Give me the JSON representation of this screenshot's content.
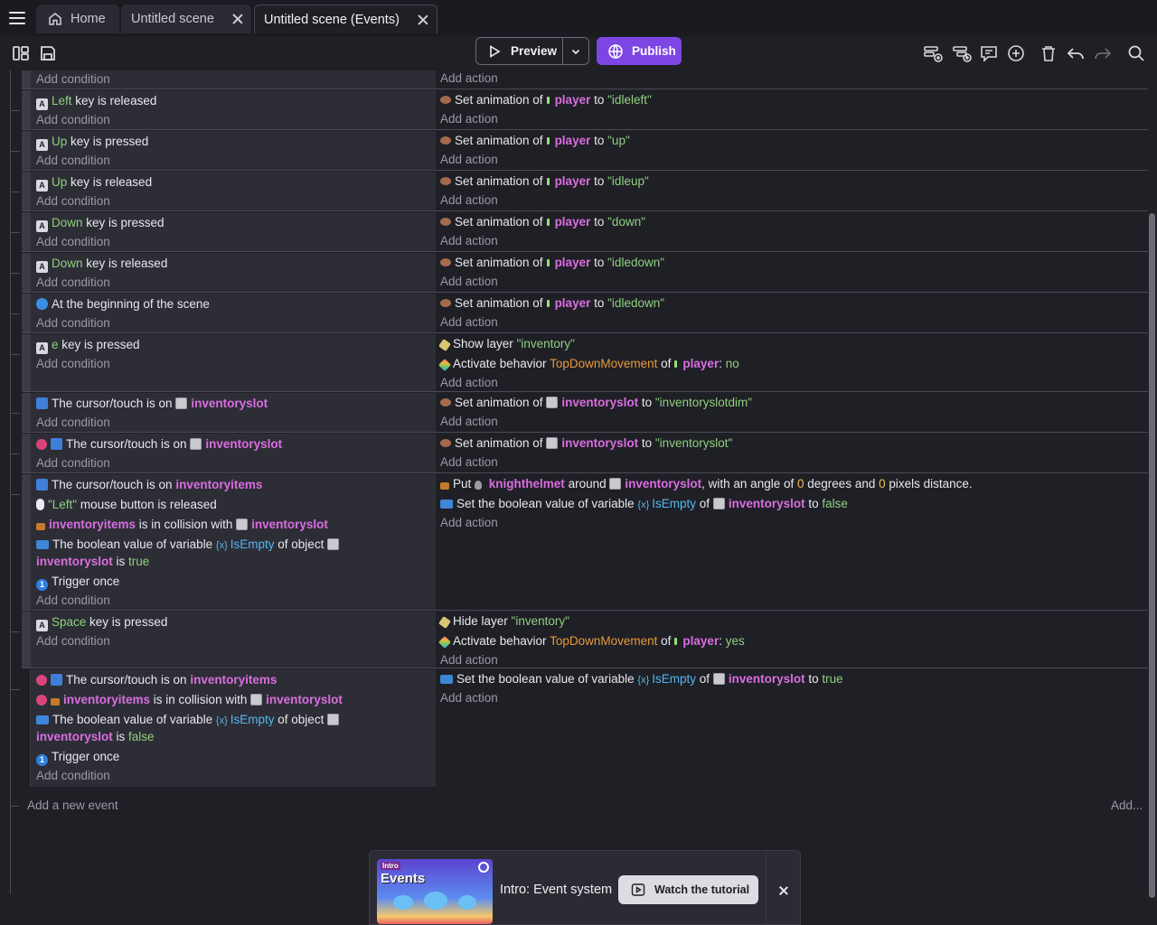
{
  "tabs": [
    {
      "label": "Home",
      "icon": "home-icon"
    },
    {
      "label": "Untitled scene",
      "icon": "close-icon"
    },
    {
      "label": "Untitled scene (Events)",
      "icon": "close-icon",
      "active": true
    }
  ],
  "toolbar": {
    "preview_label": "Preview",
    "publish_label": "Publish",
    "accent_color": "#7d46e3",
    "left_icons": [
      "layout-toggle-icon",
      "save-icon"
    ],
    "right_icons": [
      "add-event-icon",
      "add-subevent-icon",
      "add-comment-icon",
      "add-other-icon",
      "delete-icon",
      "undo-icon",
      "redo-icon",
      "search-icon"
    ]
  },
  "events": [
    {
      "conditions": [],
      "cond_add": "Add condition",
      "actions": [],
      "act_add": "Add action"
    },
    {
      "conditions": [
        {
          "parts": [
            "Left",
            "key is released"
          ]
        }
      ],
      "cond_add": "Add condition",
      "actions": [
        {
          "parts": [
            "Set animation of",
            "player",
            "to",
            "\"idleleft\""
          ]
        }
      ],
      "act_add": "Add action"
    },
    {
      "conditions": [
        {
          "parts": [
            "Up",
            "key is pressed"
          ]
        }
      ],
      "cond_add": "Add condition",
      "actions": [
        {
          "parts": [
            "Set animation of",
            "player",
            "to",
            "\"up\""
          ]
        }
      ],
      "act_add": "Add action"
    },
    {
      "conditions": [
        {
          "parts": [
            "Up",
            "key is released"
          ]
        }
      ],
      "cond_add": "Add condition",
      "actions": [
        {
          "parts": [
            "Set animation of",
            "player",
            "to",
            "\"idleup\""
          ]
        }
      ],
      "act_add": "Add action"
    },
    {
      "conditions": [
        {
          "parts": [
            "Down",
            "key is pressed"
          ]
        }
      ],
      "cond_add": "Add condition",
      "actions": [
        {
          "parts": [
            "Set animation of",
            "player",
            "to",
            "\"down\""
          ]
        }
      ],
      "act_add": "Add action"
    },
    {
      "conditions": [
        {
          "parts": [
            "Down",
            "key is released"
          ]
        }
      ],
      "cond_add": "Add condition",
      "actions": [
        {
          "parts": [
            "Set animation of",
            "player",
            "to",
            "\"idledown\""
          ]
        }
      ],
      "act_add": "Add action"
    },
    {
      "conditions": [
        {
          "parts": [
            "At the beginning of the scene"
          ]
        }
      ],
      "cond_add": "Add condition",
      "actions": [
        {
          "parts": [
            "Set animation of",
            "player",
            "to",
            "\"idledown\""
          ]
        }
      ],
      "act_add": "Add action"
    },
    {
      "conditions": [
        {
          "parts": [
            "e",
            "key is pressed"
          ]
        }
      ],
      "cond_add": "Add condition",
      "actions": [
        {
          "parts": [
            "Show layer",
            "\"inventory\""
          ]
        },
        {
          "parts": [
            "Activate behavior",
            "TopDownMovement",
            "of",
            "player",
            ": ",
            "no"
          ]
        }
      ],
      "act_add": "Add action"
    },
    {
      "conditions": [
        {
          "parts": [
            "The cursor/touch is on",
            "inventoryslot"
          ]
        }
      ],
      "cond_add": "Add condition",
      "actions": [
        {
          "parts": [
            "Set animation of",
            "inventoryslot",
            "to",
            "\"inventoryslotdim\""
          ]
        }
      ],
      "act_add": "Add action"
    },
    {
      "conditions": [
        {
          "parts": [
            "The cursor/touch is on",
            "inventoryslot"
          ]
        }
      ],
      "cond_add": "Add condition",
      "actions": [
        {
          "parts": [
            "Set animation of",
            "inventoryslot",
            "to",
            "\"inventoryslot\""
          ]
        }
      ],
      "act_add": "Add action"
    },
    {
      "conditions": [
        {
          "parts": [
            "The cursor/touch is on",
            "inventoryitems"
          ]
        },
        {
          "parts": [
            "\"Left\"",
            "mouse button is released"
          ]
        },
        {
          "parts": [
            "inventoryitems",
            "is in collision with",
            "inventoryslot"
          ]
        },
        {
          "parts": [
            "The boolean value of variable",
            "IsEmpty",
            "of object"
          ]
        },
        {
          "parts": [
            "inventoryslot",
            "is",
            "true"
          ]
        },
        {
          "parts": [
            "Trigger once"
          ]
        }
      ],
      "cond_add": "Add condition",
      "actions": [
        {
          "parts": [
            "Put",
            "knighthelmet",
            "around",
            "inventoryslot",
            ", with an angle of",
            "0",
            "degrees and",
            "0",
            "pixels distance."
          ]
        },
        {
          "parts": [
            "Set the boolean value of variable",
            "IsEmpty",
            "of",
            "inventoryslot",
            "to",
            "false"
          ]
        }
      ],
      "act_add": "Add action"
    },
    {
      "conditions": [
        {
          "parts": [
            "Space",
            "key is pressed"
          ]
        }
      ],
      "cond_add": "Add condition",
      "actions": [
        {
          "parts": [
            "Hide layer",
            "\"inventory\""
          ]
        },
        {
          "parts": [
            "Activate behavior",
            "TopDownMovement",
            "of",
            "player",
            ": ",
            "yes"
          ]
        }
      ],
      "act_add": "Add action"
    },
    {
      "conditions": [
        {
          "parts": [
            "The cursor/touch is on",
            "inventoryitems"
          ]
        },
        {
          "parts": [
            "inventoryitems",
            "is in collision with",
            "inventoryslot"
          ]
        },
        {
          "parts": [
            "The boolean value of variable",
            "IsEmpty",
            "of object"
          ]
        },
        {
          "parts": [
            "inventoryslot",
            "is",
            "false"
          ]
        },
        {
          "parts": [
            "Trigger once"
          ]
        }
      ],
      "cond_add": "Add condition",
      "actions": [
        {
          "parts": [
            "Set the boolean value of variable",
            "IsEmpty",
            "of",
            "inventoryslot",
            "to",
            "true"
          ]
        }
      ],
      "act_add": "Add action"
    }
  ],
  "footer": {
    "add_new_event": "Add a new event",
    "add_link": "Add..."
  },
  "tutorial": {
    "thumb_tag": "Intro",
    "thumb_title": "Events",
    "title": "Intro: Event system",
    "button_label": "Watch the tutorial"
  }
}
